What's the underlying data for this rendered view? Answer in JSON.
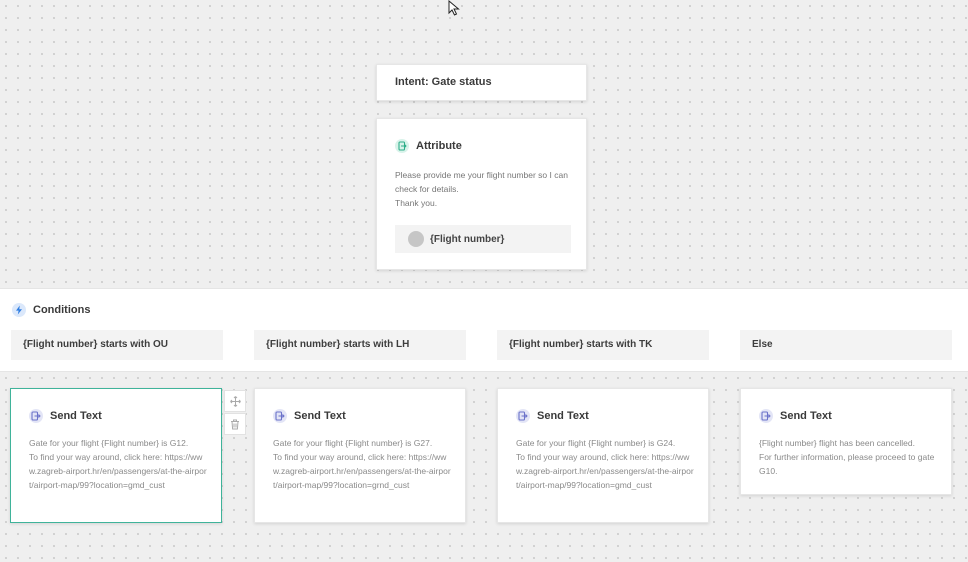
{
  "intent": {
    "title": "Intent: Gate status"
  },
  "attribute": {
    "title": "Attribute",
    "message_lines": [
      "Please provide me your flight number so I can check for details.",
      "Thank you."
    ],
    "variable": "{Flight number}"
  },
  "conditions": {
    "title": "Conditions",
    "items": [
      "{Flight number} starts with OU",
      "{Flight number} starts with LH",
      "{Flight number} starts with TK",
      "Else"
    ]
  },
  "send_text": [
    {
      "title": "Send Text",
      "lines": [
        "Gate for your flight {Flight number} is G12.",
        "To find your way around, click here: https://www.zagreb-airport.hr/en/passengers/at-the-airport/airport-map/99?location=gmd_cust"
      ]
    },
    {
      "title": "Send Text",
      "lines": [
        "Gate for your flight {Flight number} is G27.",
        "To find your way around, click here: https://www.zagreb-airport.hr/en/passengers/at-the-airport/airport-map/99?location=grnd_cust"
      ]
    },
    {
      "title": "Send Text",
      "lines": [
        "Gate for your flight {Flight number} is G24.",
        "To find your way around, click here: https://www.zagreb-airport.hr/en/passengers/at-the-airport/airport-map/99?location=gmd_cust"
      ]
    },
    {
      "title": "Send Text",
      "lines": [
        "{Flight number} flight has been cancelled.",
        "For further information, please proceed to gate G10."
      ]
    }
  ],
  "icons": {
    "attribute": "attribute-icon",
    "conditions": "lightning-icon",
    "send_text": "send-text-icon",
    "move": "move-icon",
    "delete": "trash-icon"
  },
  "colors": {
    "selected_border": "#3fb39a",
    "attribute_icon": "#2fae8a",
    "send_icon": "#6b72c9",
    "conditions_icon": "#2f7de1"
  }
}
